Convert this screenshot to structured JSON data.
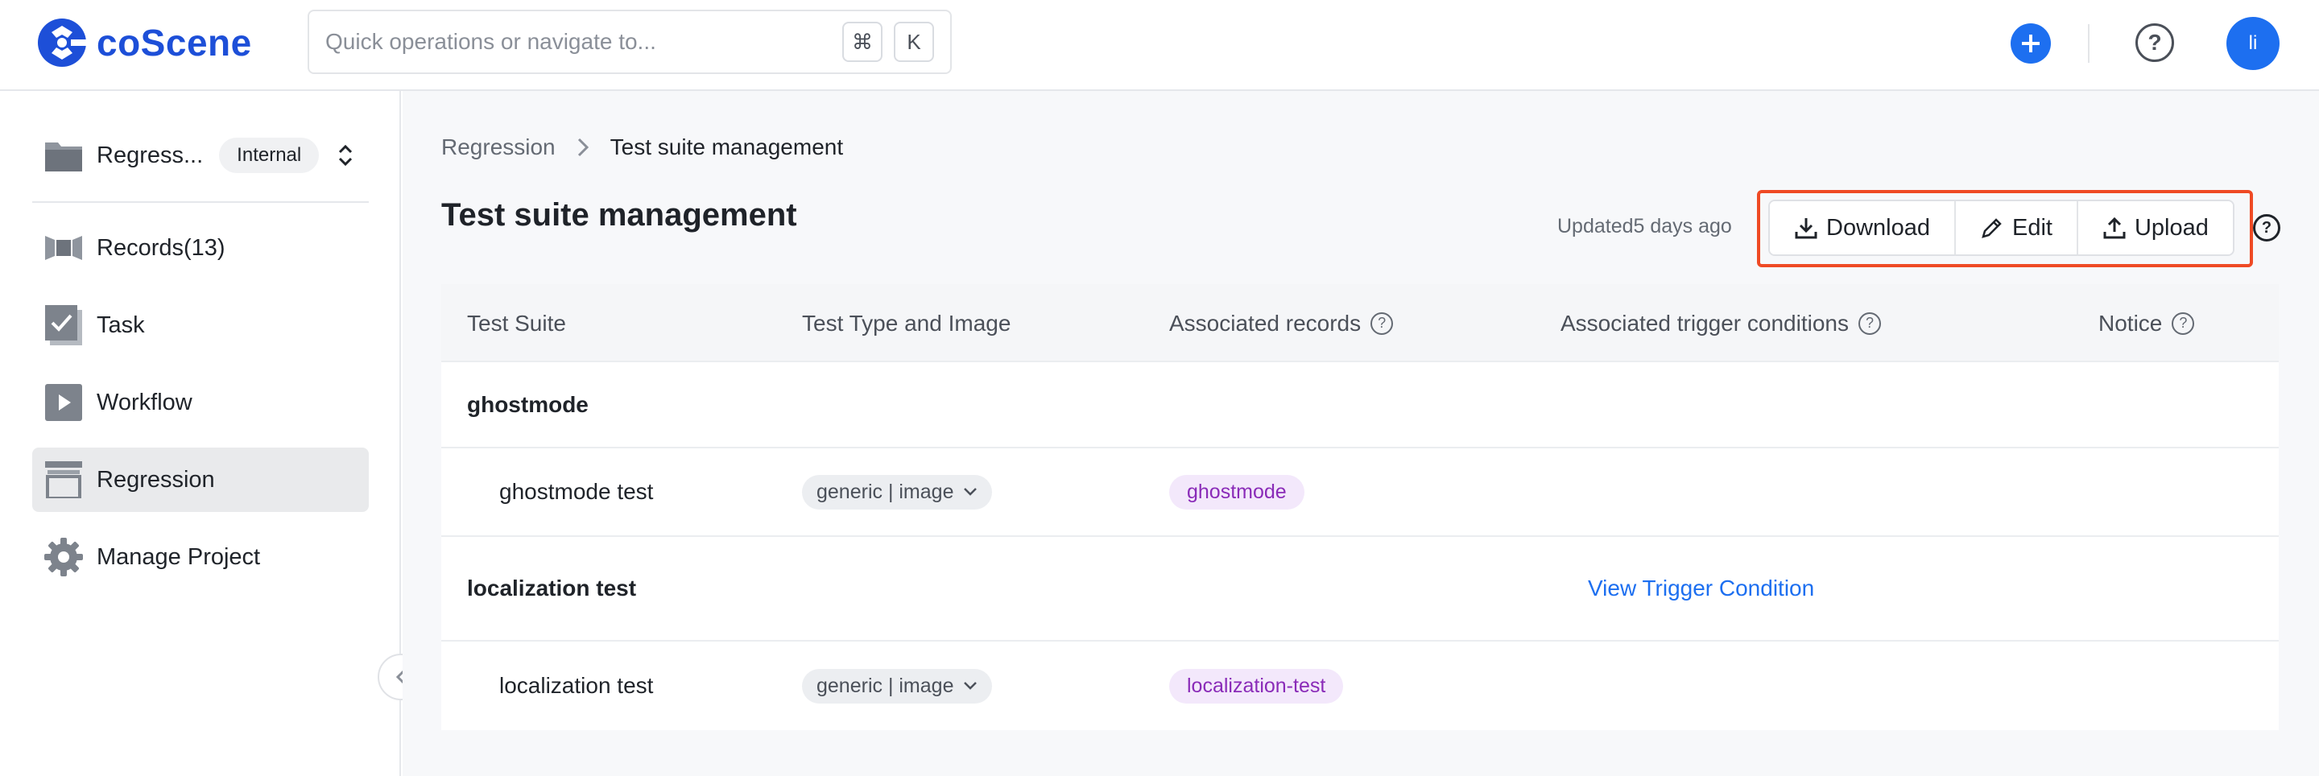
{
  "app": {
    "logo_text": "coScene",
    "brand_color": "#1d4fd8",
    "accent_color": "#1d6ff0"
  },
  "header": {
    "search_placeholder": "Quick operations or navigate to...",
    "shortcut_keys": [
      "⌘",
      "K"
    ],
    "avatar_text": "li"
  },
  "sidebar": {
    "project": {
      "name": "Regress...",
      "badge": "Internal"
    },
    "items": [
      {
        "label": "Records(13)",
        "icon": "records-icon",
        "active": false
      },
      {
        "label": "Task",
        "icon": "task-icon",
        "active": false
      },
      {
        "label": "Workflow",
        "icon": "workflow-icon",
        "active": false
      },
      {
        "label": "Regression",
        "icon": "regression-icon",
        "active": true
      },
      {
        "label": "Manage Project",
        "icon": "gear-icon",
        "active": false
      }
    ]
  },
  "main": {
    "breadcrumb": [
      "Regression",
      "Test suite management"
    ],
    "title": "Test suite management",
    "updated": "Updated5 days ago",
    "actions": {
      "download": "Download",
      "edit": "Edit",
      "upload": "Upload"
    },
    "table": {
      "headers": [
        "Test Suite",
        "Test Type and Image",
        "Associated records",
        "Associated trigger conditions",
        "Notice"
      ],
      "groups": [
        {
          "name": "ghostmode",
          "trigger_link": "",
          "rows": [
            {
              "name": "ghostmode test",
              "type_image": "generic | image",
              "record_tag": "ghostmode"
            }
          ]
        },
        {
          "name": "localization test",
          "trigger_link": "View Trigger Condition",
          "rows": [
            {
              "name": "localization test",
              "type_image": "generic | image",
              "record_tag": "localization-test"
            }
          ]
        }
      ]
    }
  }
}
